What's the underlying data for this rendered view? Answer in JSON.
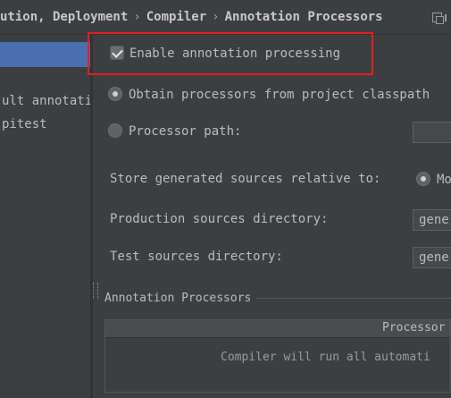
{
  "breadcrumb": {
    "items": [
      "ution, Deployment",
      "Compiler",
      "Annotation Processors"
    ],
    "separator": "›"
  },
  "left_panel": {
    "items": [
      "ult annotati",
      "pitest"
    ]
  },
  "main": {
    "enable_label": "Enable annotation processing",
    "obtain_label": "Obtain processors from project classpath",
    "processor_path_label": "Processor path:",
    "store_label": "Store generated sources relative to:",
    "store_option": "Mo",
    "production_label": "Production sources directory:",
    "production_value": "gene",
    "test_label": "Test sources directory:",
    "test_value": "gene",
    "group_title": "Annotation Processors",
    "table_header": "Processor",
    "table_empty": "Compiler will run all automati"
  },
  "colors": {
    "background": "#3c3f41",
    "selection": "#4b6eaf",
    "highlight_box": "#e02020"
  },
  "icons": [
    "copy-icon",
    "checkmark-icon",
    "radio-icon"
  ]
}
